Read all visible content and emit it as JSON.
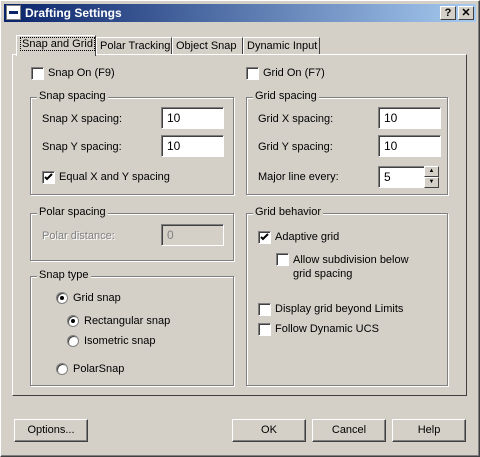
{
  "window": {
    "title": "Drafting Settings",
    "help_btn": "?",
    "close_btn": "✕"
  },
  "tabs": [
    {
      "label": "Snap and Grid"
    },
    {
      "label": "Polar Tracking"
    },
    {
      "label": "Object Snap"
    },
    {
      "label": "Dynamic Input"
    }
  ],
  "snap_on": {
    "label": "Snap On (F9)",
    "checked": false
  },
  "grid_on": {
    "label": "Grid On (F7)",
    "checked": false
  },
  "snap_spacing": {
    "title": "Snap spacing",
    "x_label": "Snap X spacing:",
    "x_value": "10",
    "y_label": "Snap Y spacing:",
    "y_value": "10",
    "equal_label": "Equal X and Y spacing",
    "equal_checked": true
  },
  "grid_spacing": {
    "title": "Grid spacing",
    "x_label": "Grid X spacing:",
    "x_value": "10",
    "y_label": "Grid Y spacing:",
    "y_value": "10",
    "major_label": "Major line every:",
    "major_value": "5"
  },
  "polar_spacing": {
    "title": "Polar spacing",
    "distance_label": "Polar distance:",
    "distance_value": "0"
  },
  "snap_type": {
    "title": "Snap type",
    "grid_snap": "Grid snap",
    "rect_snap": "Rectangular snap",
    "iso_snap": "Isometric snap",
    "polar_snap": "PolarSnap"
  },
  "grid_behavior": {
    "title": "Grid behavior",
    "adaptive": "Adaptive grid",
    "subdivision_line1": "Allow subdivision below",
    "subdivision_line2": "grid spacing",
    "beyond_limits": "Display grid beyond Limits",
    "follow_ucs": "Follow Dynamic UCS"
  },
  "buttons": {
    "options": "Options...",
    "ok": "OK",
    "cancel": "Cancel",
    "help": "Help"
  }
}
